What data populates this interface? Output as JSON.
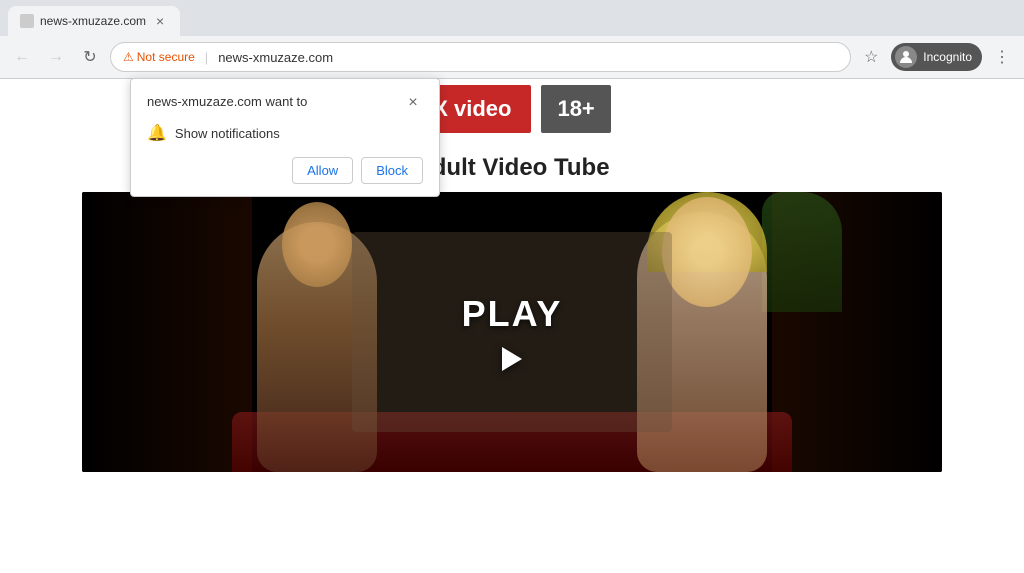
{
  "browser": {
    "tab_label": "news-xmuzaze.com",
    "back_btn": "←",
    "forward_btn": "→",
    "refresh_btn": "↻",
    "security_label": "Not secure",
    "url": "news-xmuzaze.com",
    "incognito_label": "Incognito",
    "star_icon": "☆",
    "menu_icon": "⋮"
  },
  "notification_popup": {
    "title": "news-xmuzaze.com want to",
    "close_label": "×",
    "notification_item": "Show notifications",
    "allow_label": "Allow",
    "block_label": "Block"
  },
  "website": {
    "logo_text": "X video",
    "age_badge": "18+",
    "site_title": "Adult Video Tube",
    "play_label": "PLAY"
  }
}
